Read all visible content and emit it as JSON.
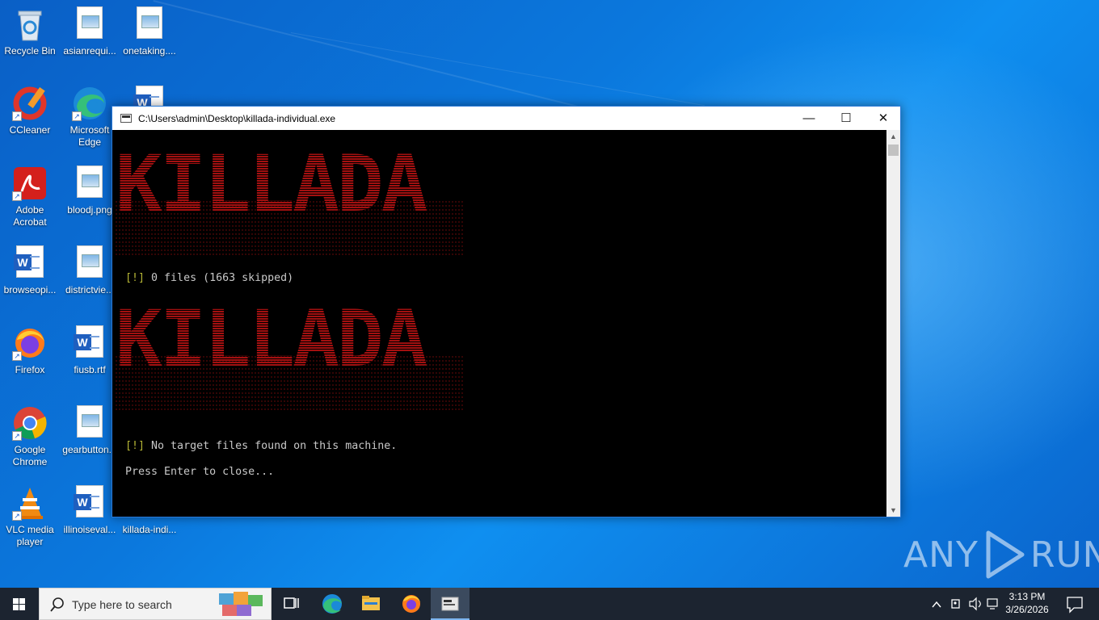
{
  "desktop_icons": [
    {
      "label": "Recycle Bin",
      "icon": "recycle-bin-icon"
    },
    {
      "label": "asianrequi...",
      "icon": "image-file-icon"
    },
    {
      "label": "onetaking....",
      "icon": "image-file-icon"
    },
    {
      "label": "CCleaner",
      "icon": "ccleaner-icon"
    },
    {
      "label": "Microsoft Edge",
      "icon": "edge-icon"
    },
    {
      "label": "Adobe Acrobat",
      "icon": "acrobat-icon"
    },
    {
      "label": "bloodj.png",
      "icon": "image-file-icon"
    },
    {
      "label": "browseopi...",
      "icon": "word-document-icon"
    },
    {
      "label": "districtvie...",
      "icon": "image-file-icon"
    },
    {
      "label": "Firefox",
      "icon": "firefox-icon"
    },
    {
      "label": "fiusb.rtf",
      "icon": "word-document-icon"
    },
    {
      "label": "Google Chrome",
      "icon": "chrome-icon"
    },
    {
      "label": "gearbutton...",
      "icon": "image-file-icon"
    },
    {
      "label": "VLC media player",
      "icon": "vlc-icon"
    },
    {
      "label": "illinoiseval...",
      "icon": "word-document-icon"
    },
    {
      "label": "killada-indi...",
      "icon": "word-document-icon"
    }
  ],
  "window": {
    "title": "C:\\Users\\admin\\Desktop\\killada-individual.exe",
    "controls": {
      "minimize": "—",
      "maximize": "☐",
      "close": "✕"
    }
  },
  "console": {
    "banner_text": "KILLADA",
    "banner_color": "#a31010",
    "line1_bracket": "[!]",
    "line1_text": " 0 files (1663 skipped)",
    "line2_bracket": "[!]",
    "line2_text": " No target files found on this machine.",
    "line3_text": "Press Enter to close..."
  },
  "taskbar": {
    "search_placeholder": "Type here to search",
    "apps": [
      "task-view-icon",
      "edge-icon",
      "file-explorer-icon",
      "firefox-icon",
      "console-app-icon"
    ],
    "clock_time": "3:13 PM",
    "clock_date": "3/26/2026"
  },
  "watermark": {
    "left": "ANY",
    "right": "RUN"
  }
}
